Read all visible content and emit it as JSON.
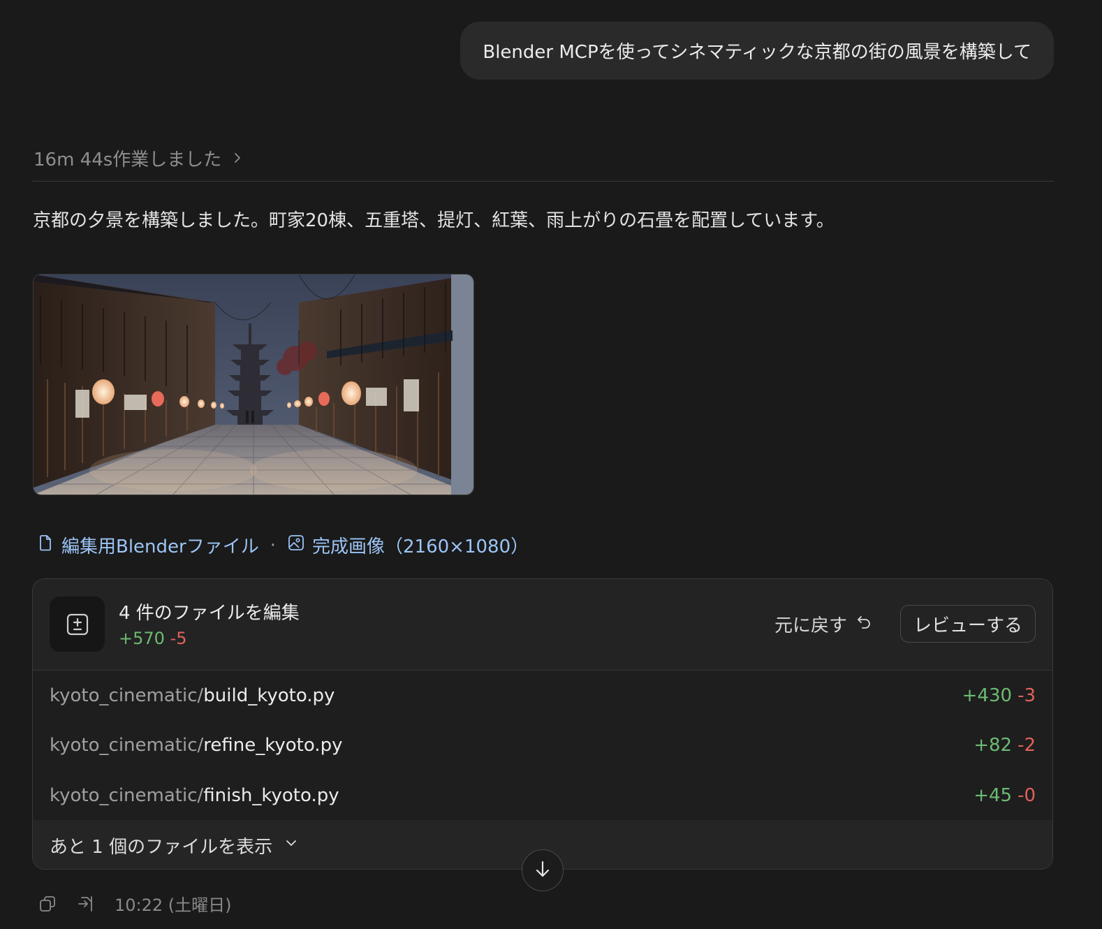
{
  "user_message": "Blender MCPを使ってシネマティックな京都の街の風景を構築して",
  "worked_label": "16m 44s作業しました",
  "response_text": "京都の夕景を構築しました。町家20棟、五重塔、提灯、紅葉、雨上がりの石畳を配置しています。",
  "links": {
    "blender_file": "編集用Blenderファイル",
    "separator": "·",
    "final_image": "完成画像（2160×1080）"
  },
  "changes": {
    "title": "4 件のファイルを編集",
    "added": "+570",
    "removed": "-5",
    "undo_label": "元に戻す",
    "review_label": "レビューする",
    "files": [
      {
        "dir": "kyoto_cinematic/",
        "name": "build_kyoto.py",
        "added": "+430",
        "removed": "-3"
      },
      {
        "dir": "kyoto_cinematic/",
        "name": "refine_kyoto.py",
        "added": "+82",
        "removed": "-2"
      },
      {
        "dir": "kyoto_cinematic/",
        "name": "finish_kyoto.py",
        "added": "+45",
        "removed": "-0"
      }
    ],
    "more_label": "あと 1 個のファイルを表示"
  },
  "footer": {
    "timestamp": "10:22 (土曜日)"
  },
  "icons": {
    "chevron": "chevron-right-icon",
    "file": "file-icon",
    "image": "image-icon",
    "diff": "diff-icon",
    "undo": "undo-icon",
    "expand": "chevron-down-icon",
    "scroll": "arrow-down-icon",
    "copy": "copy-icon",
    "branch": "branch-icon"
  },
  "colors": {
    "background": "#1a1a1a",
    "link": "#9cc4f5",
    "added": "#6cbb72",
    "removed": "#e0625a"
  }
}
